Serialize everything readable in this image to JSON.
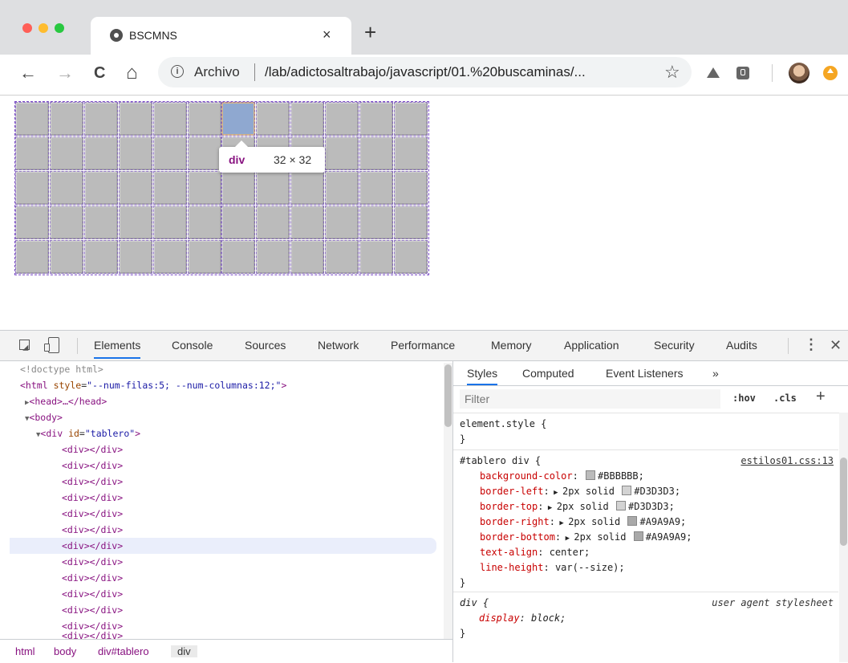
{
  "browser": {
    "tab_title": "BSCMNS",
    "tab_close": "×",
    "new_tab": "+",
    "back": "←",
    "forward": "→",
    "reload": "C",
    "home": "⌂",
    "info": "i",
    "scheme_label": "Archivo",
    "url": "/lab/adictosaltrabajo/javascript/01.%20buscaminas/...",
    "star": "☆",
    "traffic_colors": [
      "#ff5f57",
      "#febc2e",
      "#28c840"
    ]
  },
  "page": {
    "rows": 5,
    "columns": 12,
    "highlight_cell": [
      0,
      6
    ],
    "cell_colors": {
      "background": "#BBBBBB",
      "light": "#D3D3D3",
      "dark": "#A9A9A9",
      "highlight": "#8fa8d0"
    },
    "tooltip": {
      "tag": "div",
      "size": "32 × 32"
    }
  },
  "devtools": {
    "tabs": [
      "Elements",
      "Console",
      "Sources",
      "Network",
      "Performance",
      "Memory",
      "Application",
      "Security",
      "Audits"
    ],
    "kebab": "⋮",
    "close": "✕",
    "dom": {
      "doctype": "<!doctype html>",
      "html_open": "<html",
      "html_attr_name": "style",
      "html_attr_value": "\"--num-filas:5; --num-columnas:12;\"",
      "html_close": ">",
      "head": "<head>…</head>",
      "body": "<body>",
      "div_open": "<div",
      "div_attr_name": "id",
      "div_attr_value": "\"tablero\"",
      "div_close": ">",
      "child": "<div></div>",
      "child_count": 12,
      "selected_index": 6
    },
    "breadcrumbs": [
      "html",
      "body",
      "div#tablero",
      "div"
    ],
    "styles": {
      "tabs": [
        "Styles",
        "Computed",
        "Event Listeners",
        "»"
      ],
      "filter_placeholder": "Filter",
      "hov": ":hov",
      "cls": ".cls",
      "add": "+",
      "element_style": {
        "selector": "element.style {",
        "close": "}"
      },
      "tablero_rule": {
        "selector": "#tablero div {",
        "source": "estilos01.css:13",
        "declarations": [
          {
            "name": "background-color",
            "value": "#BBBBBB",
            "swatch": "#BBBBBB",
            "arrow": false,
            "prefix": ""
          },
          {
            "name": "border-left",
            "value": "#D3D3D3;",
            "swatch": "#D3D3D3",
            "arrow": true,
            "prefix": "2px solid"
          },
          {
            "name": "border-top",
            "value": "#D3D3D3;",
            "swatch": "#D3D3D3",
            "arrow": true,
            "prefix": "2px solid"
          },
          {
            "name": "border-right",
            "value": "#A9A9A9;",
            "swatch": "#A9A9A9",
            "arrow": true,
            "prefix": "2px solid"
          },
          {
            "name": "border-bottom",
            "value": "#A9A9A9;",
            "swatch": "#A9A9A9",
            "arrow": true,
            "prefix": "2px solid"
          },
          {
            "name": "text-align",
            "value": "center;",
            "swatch": null,
            "arrow": false,
            "prefix": ""
          },
          {
            "name": "line-height",
            "value": "var(--size);",
            "swatch": null,
            "arrow": false,
            "prefix": ""
          }
        ],
        "close": "}"
      },
      "ua_rule": {
        "selector": "div {",
        "source": "user agent stylesheet",
        "decl_name": "display",
        "decl_value": "block;",
        "close": "}"
      }
    }
  }
}
